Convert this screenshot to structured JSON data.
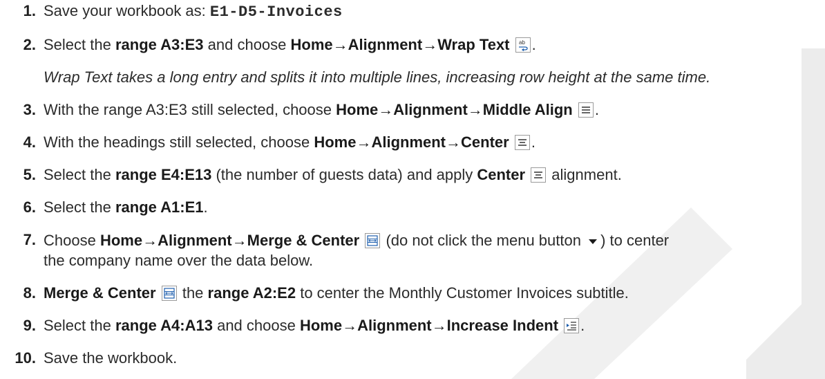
{
  "steps": [
    {
      "num": "1.",
      "a": "Save your workbook as: ",
      "file": "E1-D5-Invoices"
    },
    {
      "num": "2.",
      "a": "Select the ",
      "b": "range A3:E3",
      "c": " and choose ",
      "d": "Home→Alignment→Wrap Text",
      "e": "."
    },
    {
      "num": "3.",
      "a": "With the range A3:E3 still selected, choose ",
      "b": "Home→Alignment→Middle Align",
      "c": "."
    },
    {
      "num": "4.",
      "a": "With the headings still selected, choose ",
      "b": "Home→Alignment→Center",
      "c": "."
    },
    {
      "num": "5.",
      "a": "Select the ",
      "b": "range E4:E13",
      "c": " (the number of guests data) and apply ",
      "d": "Center",
      "e": " alignment."
    },
    {
      "num": "6.",
      "a": "Select the ",
      "b": "range A1:E1",
      "c": "."
    },
    {
      "num": "7.",
      "a": "Choose ",
      "b": "Home→Alignment→Merge & Center",
      "c": " (do not click the menu button ",
      "d": ") to center",
      "line2": "the company name over the data below."
    },
    {
      "num": "8.",
      "a": "Merge & Center",
      "b": " the ",
      "c": "range A2:E2",
      "d": " to center the Monthly Customer Invoices subtitle."
    },
    {
      "num": "9.",
      "a": "Select the ",
      "b": "range A4:A13",
      "c": " and choose ",
      "d": "Home→Alignment→Increase Indent",
      "e": "."
    },
    {
      "num": "10.",
      "a": "Save the workbook."
    }
  ],
  "note": "Wrap Text takes a long entry and splits it into multiple lines, increasing row height at the same time.",
  "icons": [
    "wrap-text-icon",
    "middle-align-icon",
    "center-icon",
    "merge-center-icon",
    "dropdown-arrow-icon",
    "increase-indent-icon"
  ],
  "colors": {
    "text": "#2b2b2b",
    "accent": "#1e5fae",
    "watermark": "#e6e6e6"
  }
}
